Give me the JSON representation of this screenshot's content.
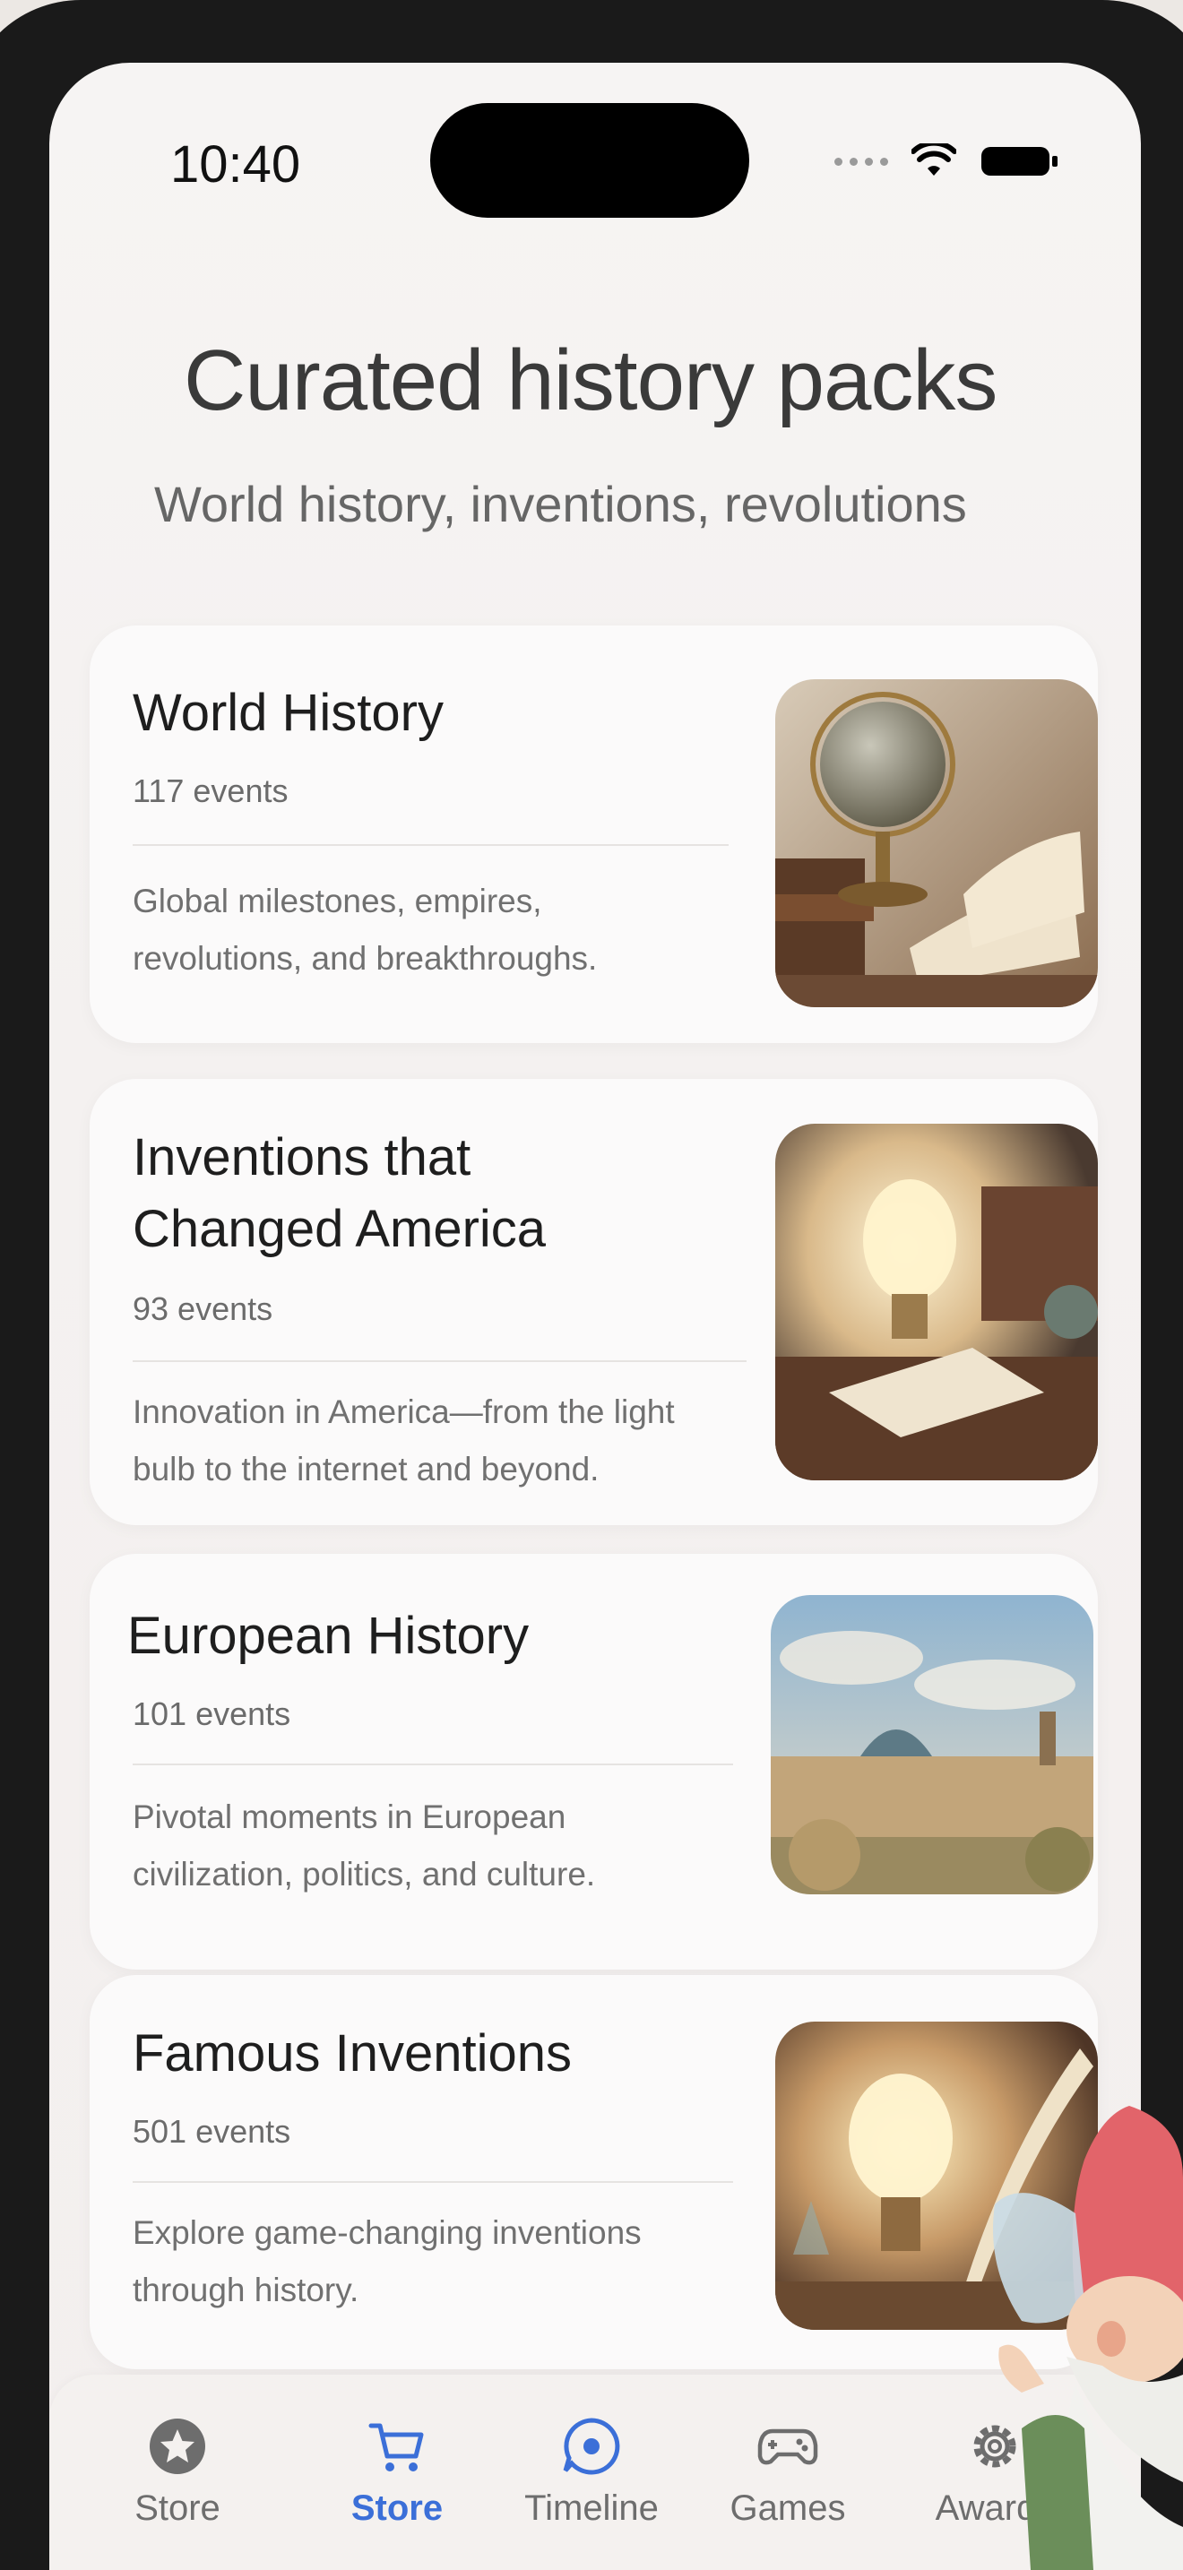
{
  "status_bar": {
    "time": "10:40"
  },
  "header": {
    "title": "Curated history packs",
    "subtitle": "World history, inventions, revolutions"
  },
  "packs": [
    {
      "title": "World History",
      "count": "117 events",
      "desc1": "Global milestones, empires,",
      "desc2": "revolutions, and breakthroughs.",
      "image_icon": "globe-books-illustration"
    },
    {
      "title1": "Inventions that",
      "title2": "Changed America",
      "count": "93 events",
      "desc1": "Innovation in America—from the light",
      "desc2": "bulb to the internet and beyond.",
      "image_icon": "lightbulb-illustration"
    },
    {
      "title": "European History",
      "count": "101 events",
      "desc1": "Pivotal moments in European",
      "desc2": "civilization, politics, and culture.",
      "image_icon": "palace-illustration"
    },
    {
      "title": "Famous Inventions",
      "count": "501 events",
      "desc1": "Explore game-changing inventions",
      "desc2": "through history.",
      "image_icon": "lightbulb-quill-illustration"
    }
  ],
  "tabs": [
    {
      "label": "Store",
      "icon": "star-icon",
      "active": false
    },
    {
      "label": "Store",
      "icon": "cart-icon",
      "active": true
    },
    {
      "label": "Timeline",
      "icon": "timeline-icon",
      "active": false
    },
    {
      "label": "Games",
      "icon": "gamepad-icon",
      "active": false
    },
    {
      "label": "Awards",
      "icon": "gear-icon",
      "active": false
    }
  ],
  "colors": {
    "accent": "#3b6fd8",
    "background": "#f6f4f3",
    "card": "#fbfafa"
  }
}
